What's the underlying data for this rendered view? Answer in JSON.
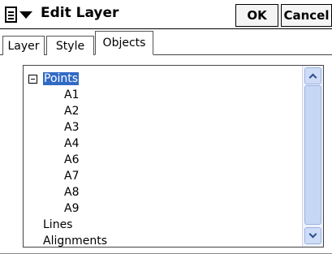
{
  "titlebar": {
    "menu_icon": "layers-menu-icon",
    "title": "Edit Layer",
    "ok_label": "OK",
    "cancel_label": "Cancel"
  },
  "tabs": [
    {
      "label": "Layer",
      "active": false
    },
    {
      "label": "Style",
      "active": false
    },
    {
      "label": "Objects",
      "active": true
    }
  ],
  "tree": {
    "items": [
      {
        "label": "Points",
        "selected": true,
        "expanded": true
      },
      {
        "label": "A1"
      },
      {
        "label": "A2"
      },
      {
        "label": "A3"
      },
      {
        "label": "A4"
      },
      {
        "label": "A6"
      },
      {
        "label": "A7"
      },
      {
        "label": "A8"
      },
      {
        "label": "A9"
      },
      {
        "label": "Lines"
      },
      {
        "label": "Alignments"
      }
    ]
  },
  "colors": {
    "selection": "#316ac5",
    "scrollbar_track": "#eef2fb",
    "scrollbar_thumb": "#c6d6f5"
  }
}
